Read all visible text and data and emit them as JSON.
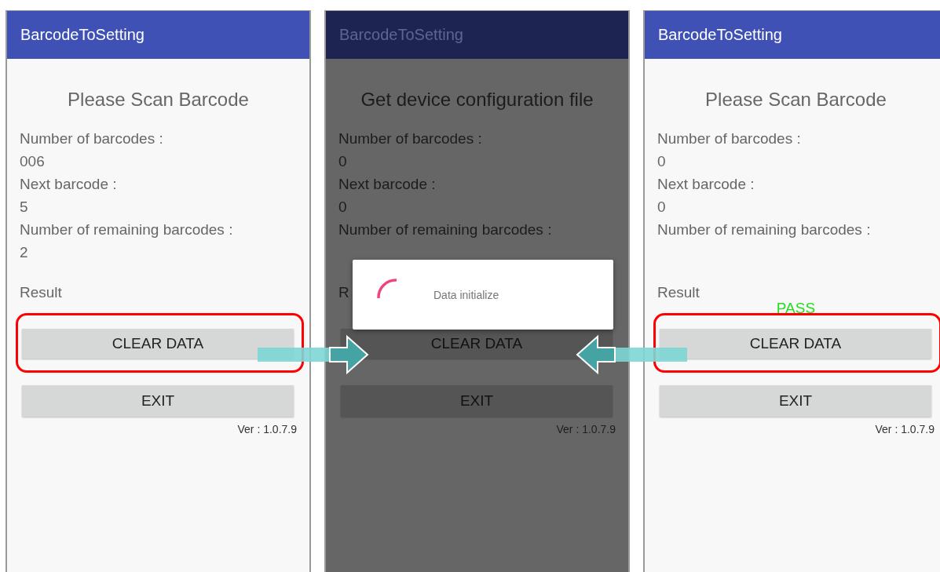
{
  "screens": [
    {
      "app_bar_title": "BarcodeToSetting",
      "dimmed": false,
      "heading": "Please Scan Barcode",
      "fields": [
        {
          "label": "Number of barcodes :",
          "value": "006"
        },
        {
          "label": "Next barcode :",
          "value": "5"
        },
        {
          "label": "Number of remaining barcodes :",
          "value": "2"
        }
      ],
      "result_label": "Result",
      "highlighted": true,
      "buttons": [
        "CLEAR DATA",
        "EXIT"
      ],
      "version": "Ver : 1.0.7.9"
    },
    {
      "app_bar_title": "BarcodeToSetting",
      "dimmed": true,
      "heading": "Get device configuration file",
      "fields": [
        {
          "label": "Number of barcodes :",
          "value": "0"
        },
        {
          "label": "Next barcode :",
          "value": "0"
        },
        {
          "label": "Number of remaining barcodes :"
        }
      ],
      "result_label": "R",
      "highlighted": false,
      "buttons": [
        "CLEAR DATA",
        "EXIT"
      ],
      "version": "Ver : 1.0.7.9",
      "dialog": {
        "message": "Data initialize"
      }
    },
    {
      "app_bar_title": "BarcodeToSetting",
      "dimmed": false,
      "heading": "Please Scan Barcode",
      "fields": [
        {
          "label": "Number of barcodes :",
          "value": "0"
        },
        {
          "label": "Next barcode :",
          "value": "0"
        },
        {
          "label": "Number of remaining barcodes :"
        }
      ],
      "result_label": "Result",
      "result_value": "PASS",
      "highlighted": true,
      "buttons": [
        "CLEAR DATA",
        "EXIT"
      ],
      "version": "Ver : 1.0.7.9"
    }
  ],
  "arrows": [
    {
      "kind": "rightward"
    },
    {
      "kind": "leftward"
    }
  ]
}
